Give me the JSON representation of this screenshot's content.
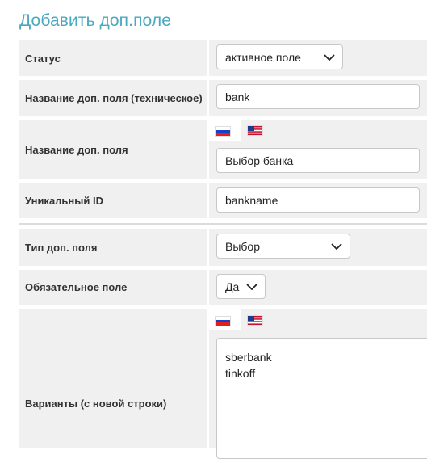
{
  "page": {
    "title": "Добавить доп.поле"
  },
  "form": {
    "status": {
      "label": "Статус",
      "value": "активное поле"
    },
    "tech_name": {
      "label": "Название доп. поля (техническое)",
      "value": "bank"
    },
    "display_name": {
      "label": "Название доп. поля",
      "value": "Выбор банка",
      "languages": [
        "ru-flag-icon",
        "us-flag-icon"
      ]
    },
    "unique_id": {
      "label": "Уникальный ID",
      "value": "bankname"
    },
    "field_type": {
      "label": "Тип доп. поля",
      "value": "Выбор"
    },
    "required": {
      "label": "Обязательное поле",
      "value": "Да"
    },
    "variants": {
      "label": "Варианты (с новой строки)",
      "lines": [
        "sberbank",
        "tinkoff"
      ],
      "languages": [
        "ru-flag-icon",
        "us-flag-icon"
      ]
    }
  },
  "colors": {
    "title": "#4aa8c0",
    "row_bg": "#f0f0f0",
    "flag_ru_blue": "#1c3fc7",
    "flag_ru_red": "#e0201c"
  }
}
